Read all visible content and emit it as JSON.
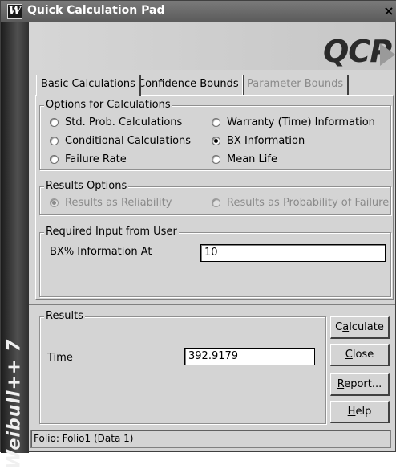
{
  "window": {
    "title": "Quick Calculation Pad",
    "icon_letter": "W",
    "close_glyph": "×"
  },
  "sidebar": {
    "product_label": "Weibull++ 7"
  },
  "logo": {
    "text": "QCP"
  },
  "tabs": [
    {
      "label": "Basic Calculations",
      "active": true,
      "enabled": true
    },
    {
      "label": "Confidence Bounds",
      "active": false,
      "enabled": true
    },
    {
      "label": "Parameter Bounds",
      "active": false,
      "enabled": false
    }
  ],
  "options_group": {
    "title": "Options for Calculations",
    "items": [
      {
        "label": "Std. Prob. Calculations",
        "selected": false
      },
      {
        "label": "Warranty (Time) Information",
        "selected": false
      },
      {
        "label": "Conditional Calculations",
        "selected": false
      },
      {
        "label": "BX Information",
        "selected": true
      },
      {
        "label": "Failure Rate",
        "selected": false
      },
      {
        "label": "Mean Life",
        "selected": false
      }
    ]
  },
  "results_options": {
    "title": "Results Options",
    "items": [
      {
        "label": "Results as Reliability",
        "selected": true,
        "enabled": false
      },
      {
        "label": "Results as Probability of Failure",
        "selected": false,
        "enabled": false
      }
    ]
  },
  "required_input": {
    "title": "Required Input from User",
    "label": "BX% Information At",
    "value": "10"
  },
  "results": {
    "title": "Results",
    "label": "Time",
    "value": "392.9179"
  },
  "buttons": {
    "calculate": {
      "pre": "C",
      "u": "a",
      "post": "lculate"
    },
    "close": {
      "pre": "",
      "u": "C",
      "post": "lose"
    },
    "report": {
      "pre": "",
      "u": "R",
      "post": "eport..."
    },
    "help": {
      "pre": "",
      "u": "H",
      "post": "elp"
    }
  },
  "status": {
    "text": "Folio: Folio1 (Data 1)"
  },
  "colors": {
    "titlebar": "#6a6a6a",
    "dialog_bg": "#d4d4d4",
    "sidebar": "#333333"
  }
}
